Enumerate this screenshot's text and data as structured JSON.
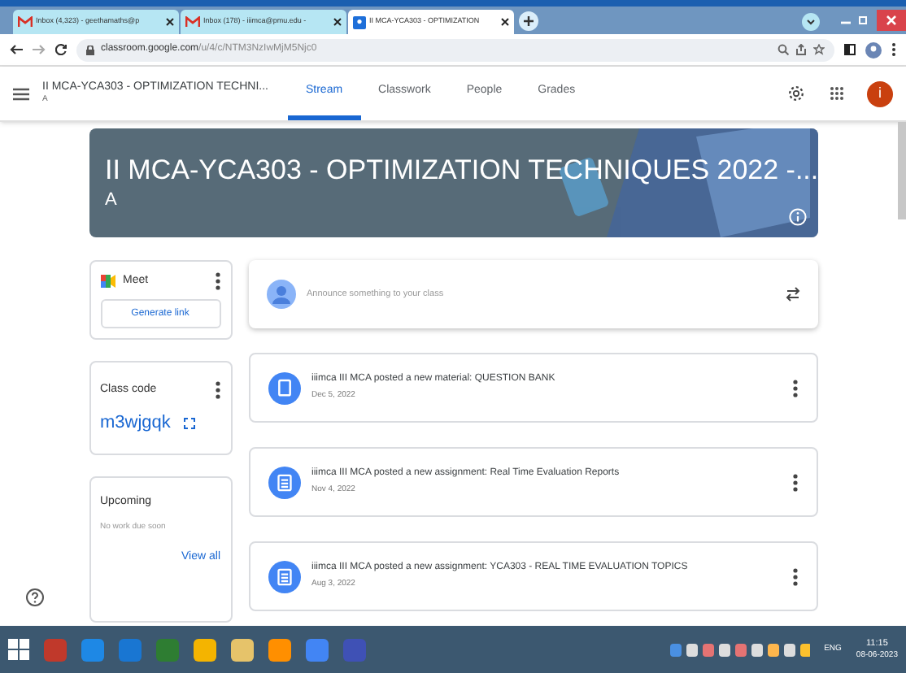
{
  "browser_tabs": [
    {
      "kind": "mail",
      "label": "Inbox (4,323) - geethamaths@p",
      "selected": false
    },
    {
      "kind": "mail",
      "label": "Inbox (178) - iiimca@pmu.edu -",
      "selected": false
    },
    {
      "kind": "classroom",
      "label": "II MCA-YCA303 - OPTIMIZATION",
      "selected": true
    }
  ],
  "address": {
    "host": "classroom.google.com",
    "path": "/u/4/c/NTM3NzIwMjM5Njc0"
  },
  "class_header": {
    "title": "II MCA-YCA303 - OPTIMIZATION TECHNI...",
    "subtitle": "A",
    "avatar_letter": "i"
  },
  "nav_tabs": [
    {
      "label": "Stream",
      "selected": true
    },
    {
      "label": "Classwork",
      "selected": false
    },
    {
      "label": "People",
      "selected": false
    },
    {
      "label": "Grades",
      "selected": false
    }
  ],
  "banner": {
    "title": "II MCA-YCA303 - OPTIMIZATION TECHNIQUES 2022 -...",
    "section": "A"
  },
  "meet": {
    "label": "Meet",
    "button": "Generate link"
  },
  "class_code": {
    "label": "Class code",
    "code": "m3wjgqk"
  },
  "upcoming": {
    "title": "Upcoming",
    "note": "No work due soon",
    "link": "View all"
  },
  "announce": {
    "placeholder": "Announce something to your class"
  },
  "posts": [
    {
      "kind": "material",
      "text": "iiimca III MCA posted a new material: QUESTION BANK",
      "date": "Dec 5, 2022"
    },
    {
      "kind": "assignment",
      "text": "iiimca III MCA posted a new assignment: Real Time Evaluation Reports",
      "date": "Nov 4, 2022"
    },
    {
      "kind": "assignment",
      "text": "iiimca III MCA posted a new assignment: YCA303 - REAL TIME EVALUATION TOPICS",
      "date": "Aug 3, 2022"
    }
  ],
  "taskbar": {
    "language": "ENG",
    "time": "11:15",
    "date": "08-06-2023"
  }
}
